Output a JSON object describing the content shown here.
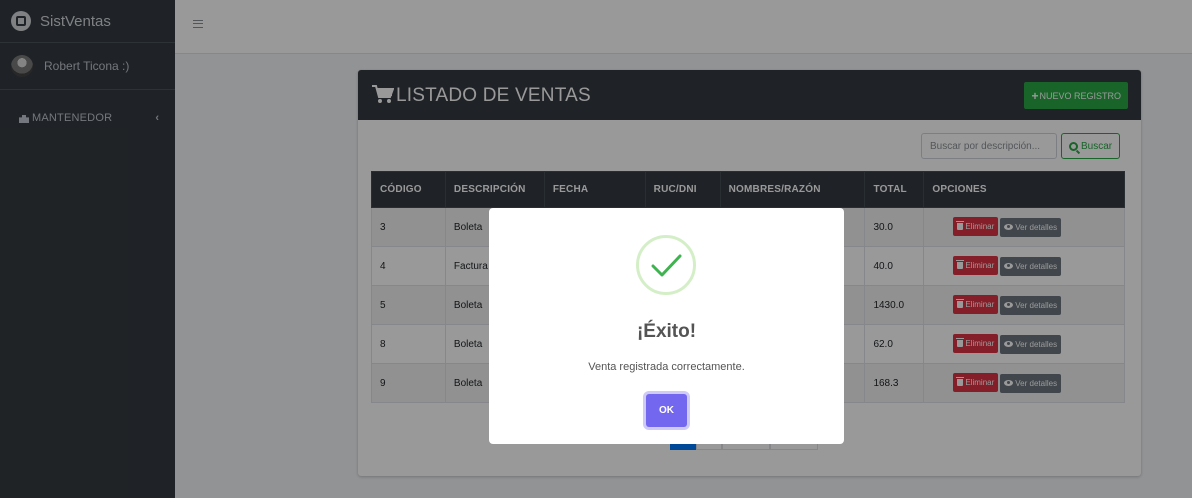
{
  "brand": {
    "name": "SistVentas"
  },
  "user": {
    "name": "Robert Ticona :)"
  },
  "sidebar": {
    "items": [
      {
        "label": "MANTENEDOR",
        "icon": "sitemap-icon"
      }
    ]
  },
  "card": {
    "title": "LISTADO DE VENTAS",
    "new_button": "NUEVO REGISTRO",
    "search_placeholder": "Buscar por descripción...",
    "search_button": "Buscar"
  },
  "table": {
    "headers": [
      "CÓDIGO",
      "DESCRIPCIÓN",
      "FECHA",
      "RUC/DNI",
      "NOMBRES/RAZÓN",
      "TOTAL",
      "OPCIONES"
    ],
    "rows": [
      {
        "codigo": "3",
        "descripcion": "Boleta",
        "total": "30.0"
      },
      {
        "codigo": "4",
        "descripcion": "Factura",
        "total": "40.0"
      },
      {
        "codigo": "5",
        "descripcion": "Boleta",
        "total": "1430.0"
      },
      {
        "codigo": "8",
        "descripcion": "Boleta",
        "total": "62.0"
      },
      {
        "codigo": "9",
        "descripcion": "Boleta",
        "total": "168.3"
      }
    ],
    "delete_label": "Eliminar",
    "view_label": "Ver detalles"
  },
  "modal": {
    "title": "¡Éxito!",
    "message": "Venta registrada correctamente.",
    "ok": "OK"
  },
  "colors": {
    "sidebar": "#343a40",
    "success": "#28a745",
    "danger": "#dc3545",
    "secondary": "#6c757d",
    "modal_button": "#7367f0"
  }
}
